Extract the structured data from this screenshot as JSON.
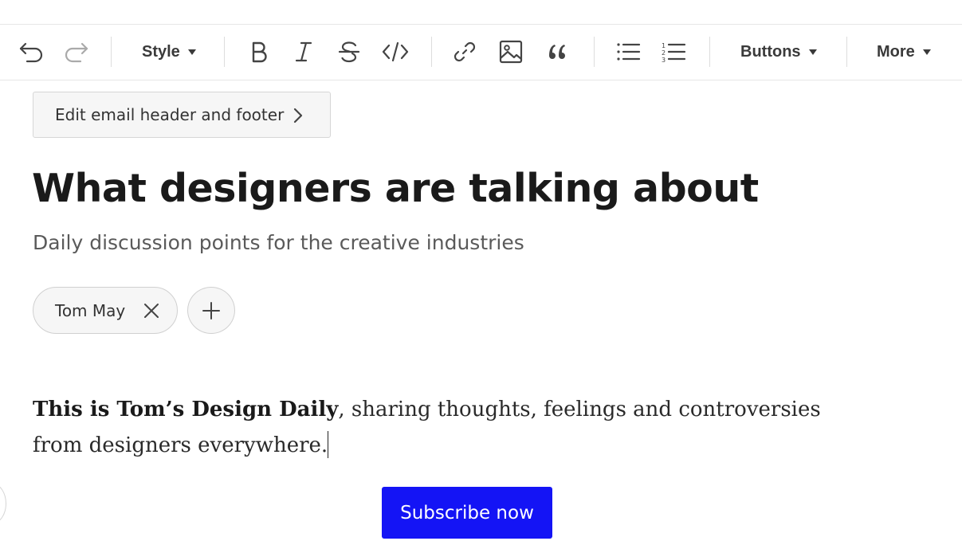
{
  "toolbar": {
    "style_label": "Style",
    "buttons_label": "Buttons",
    "more_label": "More",
    "icons": [
      "undo-icon",
      "redo-icon",
      "bold-icon",
      "italic-icon",
      "strikethrough-icon",
      "code-icon",
      "link-icon",
      "image-icon",
      "blockquote-icon",
      "bullet-list-icon",
      "numbered-list-icon"
    ]
  },
  "editor": {
    "edit_header_footer_label": "Edit email header and footer",
    "title": "What designers are talking about",
    "subtitle": "Daily discussion points for the creative industries",
    "author_name": "Tom May",
    "body_bold": "This is Tom’s Design Daily",
    "body_rest": ", sharing thoughts, feelings and controversies from designers everywhere.",
    "subscribe_label": "Subscribe now"
  },
  "colors": {
    "subscribe_bg": "#1414f5",
    "icon_color": "#444444"
  }
}
